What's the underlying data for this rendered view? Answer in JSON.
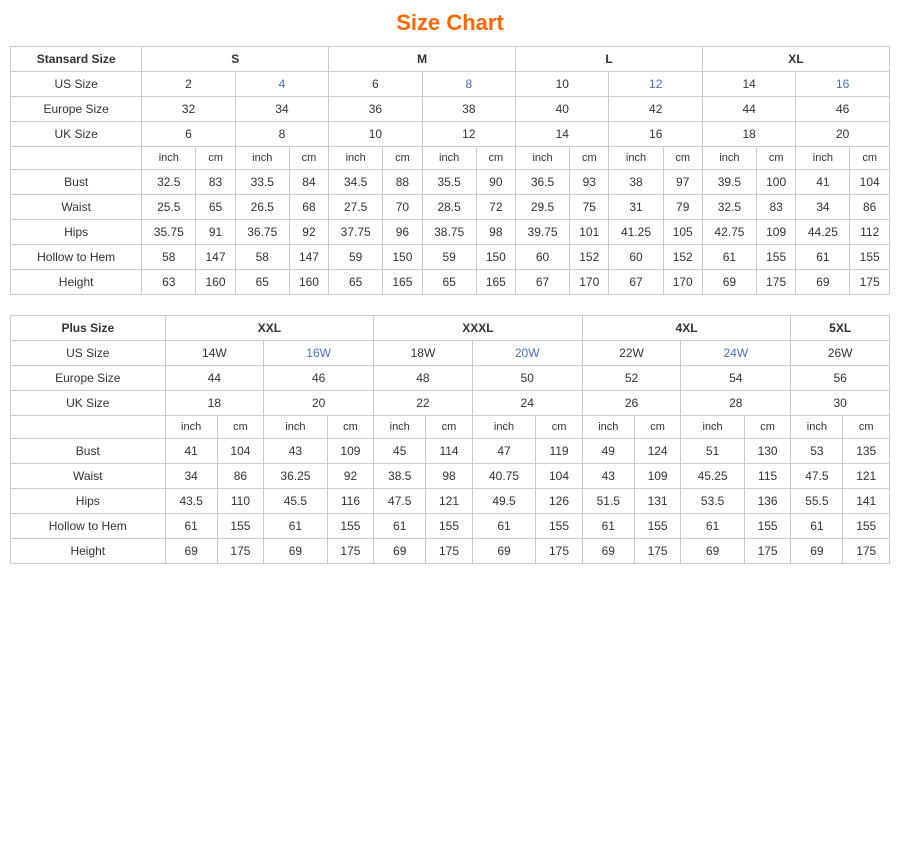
{
  "title": "Size Chart",
  "standard": {
    "headers": {
      "col0": "Stansard Size",
      "s": "S",
      "m": "M",
      "l": "L",
      "xl": "XL"
    },
    "us_size": {
      "label": "US Size",
      "values": [
        "2",
        "4",
        "6",
        "8",
        "10",
        "12",
        "14",
        "16"
      ]
    },
    "europe_size": {
      "label": "Europe Size",
      "values": [
        "32",
        "34",
        "36",
        "38",
        "40",
        "42",
        "44",
        "46"
      ]
    },
    "uk_size": {
      "label": "UK Size",
      "values": [
        "6",
        "8",
        "10",
        "12",
        "14",
        "16",
        "18",
        "20"
      ]
    },
    "subheader": [
      "inch",
      "cm",
      "inch",
      "cm",
      "inch",
      "cm",
      "inch",
      "cm",
      "inch",
      "cm",
      "inch",
      "cm",
      "inch",
      "cm",
      "inch",
      "cm"
    ],
    "bust": {
      "label": "Bust",
      "values": [
        "32.5",
        "83",
        "33.5",
        "84",
        "34.5",
        "88",
        "35.5",
        "90",
        "36.5",
        "93",
        "38",
        "97",
        "39.5",
        "100",
        "41",
        "104"
      ]
    },
    "waist": {
      "label": "Waist",
      "values": [
        "25.5",
        "65",
        "26.5",
        "68",
        "27.5",
        "70",
        "28.5",
        "72",
        "29.5",
        "75",
        "31",
        "79",
        "32.5",
        "83",
        "34",
        "86"
      ]
    },
    "hips": {
      "label": "Hips",
      "values": [
        "35.75",
        "91",
        "36.75",
        "92",
        "37.75",
        "96",
        "38.75",
        "98",
        "39.75",
        "101",
        "41.25",
        "105",
        "42.75",
        "109",
        "44.25",
        "112"
      ]
    },
    "hollow": {
      "label": "Hollow to Hem",
      "values": [
        "58",
        "147",
        "58",
        "147",
        "59",
        "150",
        "59",
        "150",
        "60",
        "152",
        "60",
        "152",
        "61",
        "155",
        "61",
        "155"
      ]
    },
    "height": {
      "label": "Height",
      "values": [
        "63",
        "160",
        "65",
        "160",
        "65",
        "165",
        "65",
        "165",
        "67",
        "170",
        "67",
        "170",
        "69",
        "175",
        "69",
        "175"
      ]
    }
  },
  "plus": {
    "headers": {
      "col0": "Plus Size",
      "xxl": "XXL",
      "xxxl": "XXXL",
      "4xl": "4XL",
      "5xl": "5XL"
    },
    "us_size": {
      "label": "US Size",
      "values": [
        "14W",
        "16W",
        "18W",
        "20W",
        "22W",
        "24W",
        "26W"
      ]
    },
    "europe_size": {
      "label": "Europe Size",
      "values": [
        "44",
        "46",
        "48",
        "50",
        "52",
        "54",
        "56"
      ]
    },
    "uk_size": {
      "label": "UK Size",
      "values": [
        "18",
        "20",
        "22",
        "24",
        "26",
        "28",
        "30"
      ]
    },
    "subheader": [
      "inch",
      "cm",
      "inch",
      "cm",
      "inch",
      "cm",
      "inch",
      "cm",
      "inch",
      "cm",
      "inch",
      "cm",
      "inch",
      "cm"
    ],
    "bust": {
      "label": "Bust",
      "values": [
        "41",
        "104",
        "43",
        "109",
        "45",
        "114",
        "47",
        "119",
        "49",
        "124",
        "51",
        "130",
        "53",
        "135"
      ]
    },
    "waist": {
      "label": "Waist",
      "values": [
        "34",
        "86",
        "36.25",
        "92",
        "38.5",
        "98",
        "40.75",
        "104",
        "43",
        "109",
        "45.25",
        "115",
        "47.5",
        "121"
      ]
    },
    "hips": {
      "label": "Hips",
      "values": [
        "43.5",
        "110",
        "45.5",
        "116",
        "47.5",
        "121",
        "49.5",
        "126",
        "51.5",
        "131",
        "53.5",
        "136",
        "55.5",
        "141"
      ]
    },
    "hollow": {
      "label": "Hollow to Hem",
      "values": [
        "61",
        "155",
        "61",
        "155",
        "61",
        "155",
        "61",
        "155",
        "61",
        "155",
        "61",
        "155",
        "61",
        "155"
      ]
    },
    "height": {
      "label": "Height",
      "values": [
        "69",
        "175",
        "69",
        "175",
        "69",
        "175",
        "69",
        "175",
        "69",
        "175",
        "69",
        "175",
        "69",
        "175"
      ]
    }
  }
}
